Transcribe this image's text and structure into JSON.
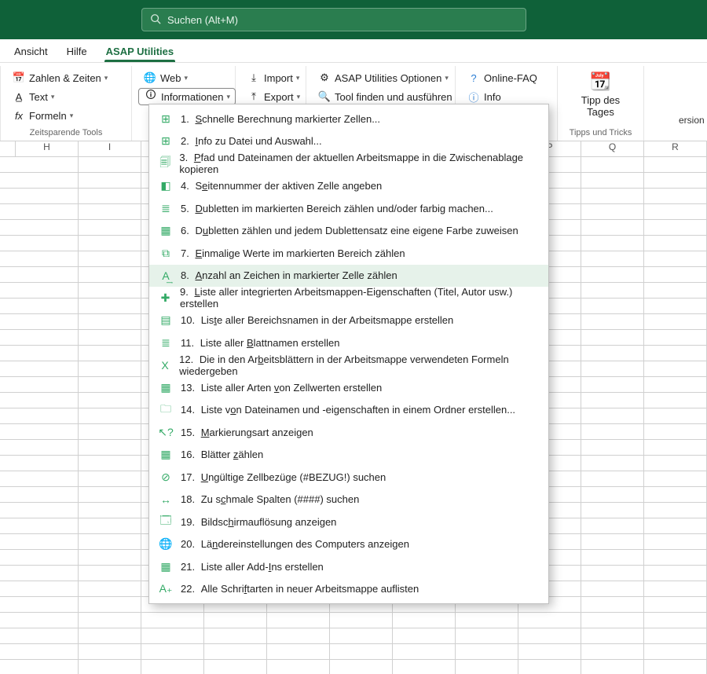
{
  "search": {
    "placeholder": "Suchen (Alt+M)"
  },
  "tabs": {
    "ansicht": "Ansicht",
    "hilfe": "Hilfe",
    "asap": "ASAP Utilities"
  },
  "ribbon": {
    "groupA": {
      "zahlen": "Zahlen & Zeiten",
      "text": "Text",
      "formeln": "Formeln",
      "caption": "Zeitsparende Tools"
    },
    "groupB": {
      "web": "Web",
      "informationen": "Informationen"
    },
    "groupC": {
      "import": "Import",
      "export": "Export"
    },
    "groupD": {
      "optionen": "ASAP Utilities Optionen",
      "toolfinden": "Tool finden und ausführen"
    },
    "groupE": {
      "faq": "Online-FAQ",
      "info": "Info"
    },
    "groupF": {
      "tipp_line1": "Tipp des",
      "tipp_line2": "Tages",
      "caption": "Tipps und Tricks"
    },
    "peek": "ersion"
  },
  "columns": [
    "H",
    "I",
    "",
    "",
    "",
    "",
    "",
    "",
    "P",
    "Q",
    "R"
  ],
  "menu": {
    "items": [
      {
        "icon": "⊞",
        "n": "1.",
        "pre": "",
        "u": "S",
        "post": "chnelle Berechnung markierter Zellen..."
      },
      {
        "icon": "⊞",
        "n": "2.",
        "pre": "",
        "u": "I",
        "post": "nfo zu Datei und Auswahl..."
      },
      {
        "icon": "🗐",
        "n": "3.",
        "pre": "",
        "u": "P",
        "post": "fad und Dateinamen der aktuellen Arbeitsmappe in die Zwischenablage kopieren"
      },
      {
        "icon": "◧",
        "n": "4.",
        "pre": "S",
        "u": "e",
        "post": "itennummer der aktiven Zelle angeben"
      },
      {
        "icon": "≣",
        "n": "5.",
        "pre": "",
        "u": "D",
        "post": "ubletten im markierten Bereich zählen und/oder farbig machen..."
      },
      {
        "icon": "▦",
        "n": "6.",
        "pre": "D",
        "u": "u",
        "post": "bletten zählen und jedem Dublettensatz eine eigene Farbe zuweisen"
      },
      {
        "icon": "⧉",
        "n": "7.",
        "pre": "",
        "u": "E",
        "post": "inmalige Werte im markierten Bereich zählen"
      },
      {
        "icon": "A͢",
        "n": "8.",
        "pre": "",
        "u": "A",
        "post": "nzahl an Zeichen in markierter Zelle zählen"
      },
      {
        "icon": "✚",
        "n": "9.",
        "pre": "",
        "u": "L",
        "post": "iste aller integrierten Arbeitsmappen-Eigenschaften (Titel, Autor usw.) erstellen"
      },
      {
        "icon": "▤",
        "n": "10.",
        "pre": "Lis",
        "u": "t",
        "post": "e aller Bereichsnamen in der Arbeitsmappe erstellen"
      },
      {
        "icon": "≣",
        "n": "11.",
        "pre": "Liste aller ",
        "u": "B",
        "post": "lattnamen erstellen"
      },
      {
        "icon": "X",
        "n": "12.",
        "pre": "Die in den Ar",
        "u": "b",
        "post": "eitsblättern in der Arbeitsmappe verwendeten Formeln wiedergeben"
      },
      {
        "icon": "▦",
        "n": "13.",
        "pre": "Liste aller Arten ",
        "u": "v",
        "post": "on Zellwerten erstellen"
      },
      {
        "icon": "🗀",
        "n": "14.",
        "pre": "Liste v",
        "u": "o",
        "post": "n Dateinamen und -eigenschaften in einem Ordner erstellen..."
      },
      {
        "icon": "↖?",
        "n": "15.",
        "pre": "",
        "u": "M",
        "post": "arkierungsart anzeigen"
      },
      {
        "icon": "▦",
        "n": "16.",
        "pre": "Blätter ",
        "u": "z",
        "post": "ählen"
      },
      {
        "icon": "⊘",
        "n": "17.",
        "pre": "",
        "u": "U",
        "post": "ngültige Zellbezüge (#BEZUG!) suchen"
      },
      {
        "icon": "↔",
        "n": "18.",
        "pre": "Zu s",
        "u": "c",
        "post": "hmale Spalten (####) suchen"
      },
      {
        "icon": "🗔",
        "n": "19.",
        "pre": "Bildsc",
        "u": "h",
        "post": "irmauflösung anzeigen"
      },
      {
        "icon": "🌐",
        "n": "20.",
        "pre": "Lä",
        "u": "n",
        "post": "dereinstellungen des Computers anzeigen"
      },
      {
        "icon": "▦",
        "n": "21.",
        "pre": "Liste aller Add-",
        "u": "I",
        "post": "ns erstellen"
      },
      {
        "icon": "A₊",
        "n": "22.",
        "pre": "Alle Schri",
        "u": "f",
        "post": "tarten in neuer Arbeitsmappe auflisten"
      }
    ],
    "hover_index": 7
  }
}
